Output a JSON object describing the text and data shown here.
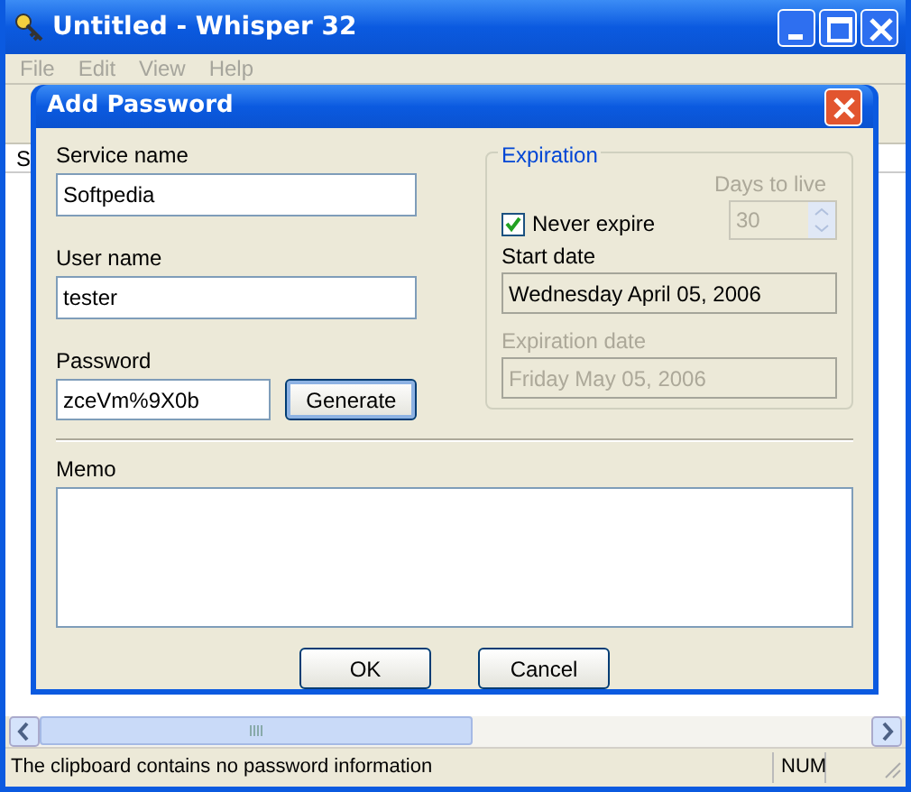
{
  "window": {
    "title": "Untitled - Whisper 32"
  },
  "menu": [
    {
      "label": "File",
      "disabled": true
    },
    {
      "label": "Edit",
      "disabled": true
    },
    {
      "label": "View",
      "disabled": true
    },
    {
      "label": "Help",
      "disabled": true
    }
  ],
  "list": {
    "column_1": "S"
  },
  "dialog": {
    "title": "Add Password",
    "fields": [
      {
        "label": "Service name",
        "value": "Softpedia"
      },
      {
        "label": "User name",
        "value": "tester"
      },
      {
        "label": "Password",
        "value": "zceVm%9X0b"
      }
    ],
    "generate_button": "Generate",
    "expiration": {
      "title": "Expiration",
      "never_expire": {
        "label": "Never expire",
        "checked": true
      },
      "days_to_live": {
        "label": "Days to live",
        "value": "30",
        "disabled": true
      },
      "start_date": {
        "label": "Start date",
        "value": "Wednesday April 05, 2006",
        "disabled": false
      },
      "expiration_date": {
        "label": "Expiration date",
        "value": "Friday May 05, 2006",
        "disabled": true
      }
    },
    "memo": {
      "label": "Memo"
    },
    "buttons": [
      "OK",
      "Cancel"
    ]
  },
  "status_bar": {
    "message": "The clipboard contains no password information",
    "panels": [
      "NUM"
    ]
  }
}
